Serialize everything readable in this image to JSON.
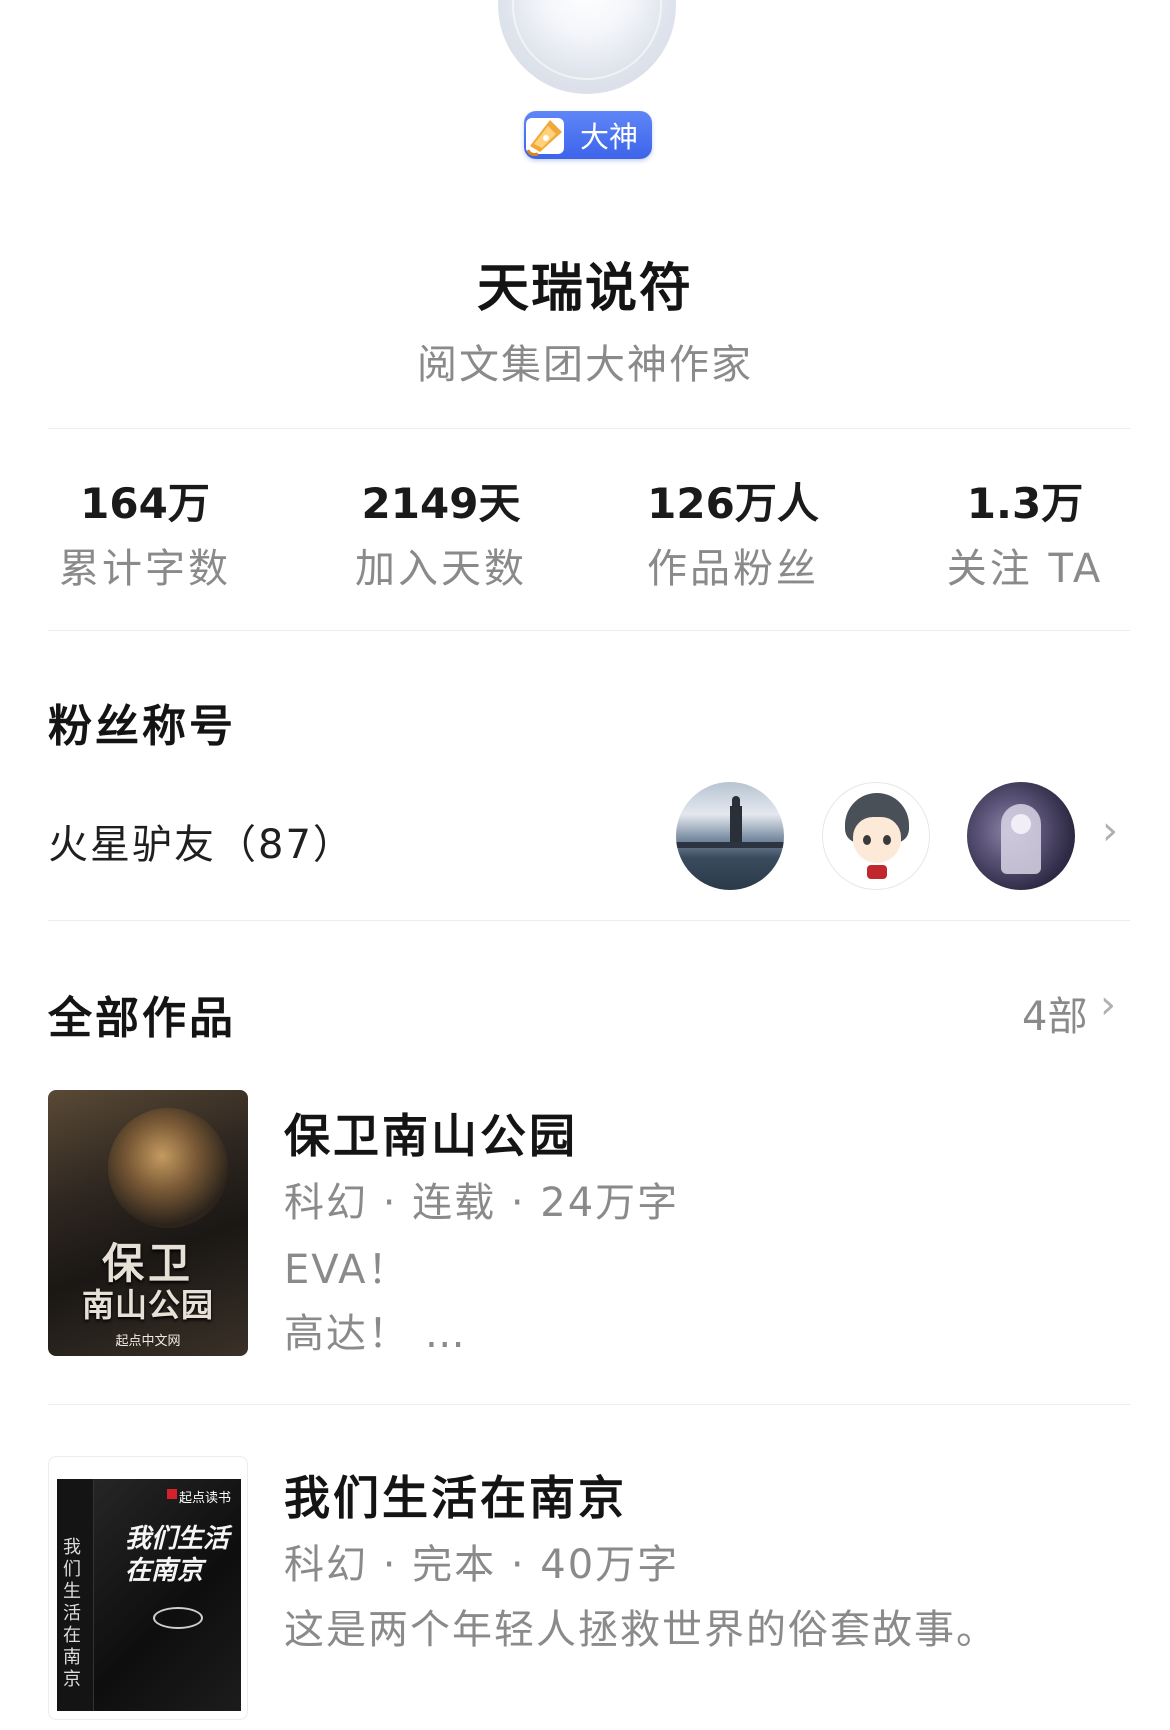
{
  "profile": {
    "badge_label": "大神",
    "name": "天瑞说符",
    "title": "阅文集团大神作家"
  },
  "stats": [
    {
      "value": "164万",
      "label": "累计字数"
    },
    {
      "value": "2149天",
      "label": "加入天数"
    },
    {
      "value": "126万人",
      "label": "作品粉丝"
    },
    {
      "value": "1.3万",
      "label": "关注 TA"
    }
  ],
  "fans": {
    "section_title": "粉丝称号",
    "fan_title": "火星驴友（87）",
    "chevron": "›"
  },
  "works": {
    "section_title": "全部作品",
    "count": "4部",
    "chevron": "›",
    "books": [
      {
        "title": "保卫南山公园",
        "meta": "科幻 · 连载 · 24万字",
        "desc_line1": "EVA！",
        "desc_line2": "高达！ …",
        "cover_text_main": "保卫",
        "cover_text_sub": "南山公园",
        "cover_publisher": "起点中文网"
      },
      {
        "title": "我们生活在南京",
        "meta": "科幻 · 完本 · 40万字",
        "desc": "这是两个年轻人拯救世界的俗套故事。",
        "cover_text_main": "我们生活在南京",
        "cover_spine": "我们生活在南京",
        "cover_publisher": "起点读书"
      }
    ]
  },
  "colors": {
    "badge_blue": "#4a6ff0",
    "text_primary": "#141414",
    "text_secondary": "#8a8a8a",
    "divider": "#ececec"
  }
}
